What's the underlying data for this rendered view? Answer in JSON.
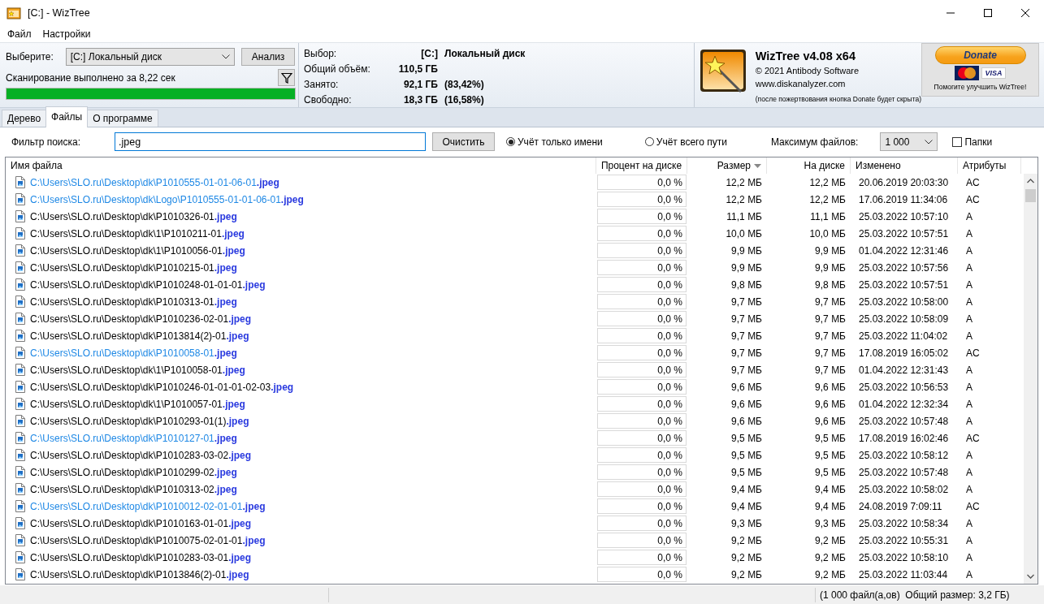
{
  "window": {
    "title": "[C:]  - WizTree"
  },
  "menu": [
    "Файл",
    "Настройки"
  ],
  "scan": {
    "select_label": "Выберите:",
    "drive": "[C:] Локальный диск",
    "analyze_button": "Анализ",
    "status": "Сканирование выполнено за 8,22 сек",
    "level": 1
  },
  "summary": [
    {
      "label": "Выбор:",
      "value": "[C:]",
      "extra": "Локальный диск"
    },
    {
      "label": "Общий объём:",
      "value": "110,5 ГБ"
    },
    {
      "label": "Занято:",
      "value": "92,1 ГБ",
      "extra": "(83,42%)"
    },
    {
      "label": "Свободно:",
      "value": "18,3 ГБ",
      "extra": "(16,58%)"
    }
  ],
  "about": {
    "product": "WizTree v4.08 x64",
    "copyright": "© 2021 Antibody Software",
    "website": "www.diskanalyzer.com",
    "note": "(после пожертвования кнопка Donate будет скрыта)"
  },
  "donate": {
    "button": "Donate",
    "card_text": "VISA",
    "caption": "Помогите улучшить WizTree!"
  },
  "tabs": [
    {
      "label": "Дерево",
      "selected": false
    },
    {
      "label": "Файлы",
      "selected": true
    },
    {
      "label": "О программе",
      "selected": false
    }
  ],
  "filter": {
    "label": "Фильтр поиска:",
    "value": ".jpeg",
    "clear_button": "Очистить",
    "match_options": [
      {
        "label": "Учёт только имени",
        "selected": true
      },
      {
        "label": "Учёт всего пути",
        "selected": false
      }
    ],
    "max_files_label": "Максимум файлов:",
    "max_files": "1 000",
    "folders": {
      "label": "Папки",
      "checked": false
    }
  },
  "table": {
    "columns": [
      {
        "label": "Имя файла",
        "sorted": false
      },
      {
        "label": "Процент на диске",
        "sorted": false
      },
      {
        "label": "Размер",
        "sorted": true
      },
      {
        "label": "На диске",
        "sorted": false
      },
      {
        "label": "Изменено",
        "sorted": false
      },
      {
        "label": "Атрибуты",
        "sorted": false
      }
    ],
    "rows": [
      {
        "path": "C:\\Users\\SLO.ru\\Desktop\\dk\\P1010555-01-01-06-01",
        "match": ".jpeg",
        "compressed": true,
        "percent": "0,0 %",
        "size": "12,2 МБ",
        "on_disk": "12,2 МБ",
        "modified": "20.06.2019 20:03:30",
        "attributes": "AC"
      },
      {
        "path": "C:\\Users\\SLO.ru\\Desktop\\dk\\Logo\\P1010555-01-01-06-01",
        "match": ".jpeg",
        "compressed": true,
        "percent": "0,0 %",
        "size": "12,2 МБ",
        "on_disk": "12,2 МБ",
        "modified": "17.06.2019 11:34:06",
        "attributes": "AC"
      },
      {
        "path": "C:\\Users\\SLO.ru\\Desktop\\dk\\P1010326-01",
        "match": ".jpeg",
        "compressed": false,
        "percent": "0,0 %",
        "size": "11,1 МБ",
        "on_disk": "11,1 МБ",
        "modified": "25.03.2022 10:57:10",
        "attributes": "A"
      },
      {
        "path": "C:\\Users\\SLO.ru\\Desktop\\dk\\1\\P1010211-01",
        "match": ".jpeg",
        "compressed": false,
        "percent": "0,0 %",
        "size": "10,0 МБ",
        "on_disk": "10,0 МБ",
        "modified": "25.03.2022 10:57:51",
        "attributes": "A"
      },
      {
        "path": "C:\\Users\\SLO.ru\\Desktop\\dk\\1\\P1010056-01",
        "match": ".jpeg",
        "compressed": false,
        "percent": "0,0 %",
        "size": "9,9 МБ",
        "on_disk": "9,9 МБ",
        "modified": "01.04.2022 12:31:46",
        "attributes": "A"
      },
      {
        "path": "C:\\Users\\SLO.ru\\Desktop\\dk\\P1010215-01",
        "match": ".jpeg",
        "compressed": false,
        "percent": "0,0 %",
        "size": "9,9 МБ",
        "on_disk": "9,9 МБ",
        "modified": "25.03.2022 10:57:56",
        "attributes": "A"
      },
      {
        "path": "C:\\Users\\SLO.ru\\Desktop\\dk\\P1010248-01-01-01",
        "match": ".jpeg",
        "compressed": false,
        "percent": "0,0 %",
        "size": "9,8 МБ",
        "on_disk": "9,8 МБ",
        "modified": "25.03.2022 10:57:51",
        "attributes": "A"
      },
      {
        "path": "C:\\Users\\SLO.ru\\Desktop\\dk\\P1010313-01",
        "match": ".jpeg",
        "compressed": false,
        "percent": "0,0 %",
        "size": "9,7 МБ",
        "on_disk": "9,7 МБ",
        "modified": "25.03.2022 10:58:00",
        "attributes": "A"
      },
      {
        "path": "C:\\Users\\SLO.ru\\Desktop\\dk\\P1010236-02-01",
        "match": ".jpeg",
        "compressed": false,
        "percent": "0,0 %",
        "size": "9,7 МБ",
        "on_disk": "9,7 МБ",
        "modified": "25.03.2022 10:58:09",
        "attributes": "A"
      },
      {
        "path": "C:\\Users\\SLO.ru\\Desktop\\dk\\P1013814(2)-01",
        "match": ".jpeg",
        "compressed": false,
        "percent": "0,0 %",
        "size": "9,7 МБ",
        "on_disk": "9,7 МБ",
        "modified": "25.03.2022 11:04:02",
        "attributes": "A"
      },
      {
        "path": "C:\\Users\\SLO.ru\\Desktop\\dk\\P1010058-01",
        "match": ".jpeg",
        "compressed": true,
        "percent": "0,0 %",
        "size": "9,7 МБ",
        "on_disk": "9,7 МБ",
        "modified": "17.08.2019 16:05:02",
        "attributes": "AC"
      },
      {
        "path": "C:\\Users\\SLO.ru\\Desktop\\dk\\1\\P1010058-01",
        "match": ".jpeg",
        "compressed": false,
        "percent": "0,0 %",
        "size": "9,7 МБ",
        "on_disk": "9,7 МБ",
        "modified": "01.04.2022 12:31:43",
        "attributes": "A"
      },
      {
        "path": "C:\\Users\\SLO.ru\\Desktop\\dk\\P1010246-01-01-01-02-03",
        "match": ".jpeg",
        "compressed": false,
        "percent": "0,0 %",
        "size": "9,6 МБ",
        "on_disk": "9,6 МБ",
        "modified": "25.03.2022 10:56:53",
        "attributes": "A"
      },
      {
        "path": "C:\\Users\\SLO.ru\\Desktop\\dk\\1\\P1010057-01",
        "match": ".jpeg",
        "compressed": false,
        "percent": "0,0 %",
        "size": "9,6 МБ",
        "on_disk": "9,6 МБ",
        "modified": "01.04.2022 12:32:34",
        "attributes": "A"
      },
      {
        "path": "C:\\Users\\SLO.ru\\Desktop\\dk\\P1010293-01(1)",
        "match": ".jpeg",
        "compressed": false,
        "percent": "0,0 %",
        "size": "9,6 МБ",
        "on_disk": "9,6 МБ",
        "modified": "25.03.2022 10:57:48",
        "attributes": "A"
      },
      {
        "path": "C:\\Users\\SLO.ru\\Desktop\\dk\\P1010127-01",
        "match": ".jpeg",
        "compressed": true,
        "percent": "0,0 %",
        "size": "9,5 МБ",
        "on_disk": "9,5 МБ",
        "modified": "17.08.2019 16:02:46",
        "attributes": "AC"
      },
      {
        "path": "C:\\Users\\SLO.ru\\Desktop\\dk\\P1010283-03-02",
        "match": ".jpeg",
        "compressed": false,
        "percent": "0,0 %",
        "size": "9,5 МБ",
        "on_disk": "9,5 МБ",
        "modified": "25.03.2022 10:58:12",
        "attributes": "A"
      },
      {
        "path": "C:\\Users\\SLO.ru\\Desktop\\dk\\P1010299-02",
        "match": ".jpeg",
        "compressed": false,
        "percent": "0,0 %",
        "size": "9,5 МБ",
        "on_disk": "9,5 МБ",
        "modified": "25.03.2022 10:57:48",
        "attributes": "A"
      },
      {
        "path": "C:\\Users\\SLO.ru\\Desktop\\dk\\P1010313-02",
        "match": ".jpeg",
        "compressed": false,
        "percent": "0,0 %",
        "size": "9,4 МБ",
        "on_disk": "9,4 МБ",
        "modified": "25.03.2022 10:58:02",
        "attributes": "A"
      },
      {
        "path": "C:\\Users\\SLO.ru\\Desktop\\dk\\P1010012-02-01-01",
        "match": ".jpeg",
        "compressed": true,
        "percent": "0,0 %",
        "size": "9,4 МБ",
        "on_disk": "9,4 МБ",
        "modified": "24.08.2019 7:09:11",
        "attributes": "AC"
      },
      {
        "path": "C:\\Users\\SLO.ru\\Desktop\\dk\\P1010163-01-01",
        "match": ".jpeg",
        "compressed": false,
        "percent": "0,0 %",
        "size": "9,3 МБ",
        "on_disk": "9,3 МБ",
        "modified": "25.03.2022 10:58:34",
        "attributes": "A"
      },
      {
        "path": "C:\\Users\\SLO.ru\\Desktop\\dk\\P1010075-02-01-01",
        "match": ".jpeg",
        "compressed": false,
        "percent": "0,0 %",
        "size": "9,2 МБ",
        "on_disk": "9,2 МБ",
        "modified": "25.03.2022 10:55:31",
        "attributes": "A"
      },
      {
        "path": "C:\\Users\\SLO.ru\\Desktop\\dk\\P1010283-03-01",
        "match": ".jpeg",
        "compressed": false,
        "percent": "0,0 %",
        "size": "9,2 МБ",
        "on_disk": "9,2 МБ",
        "modified": "25.03.2022 10:58:10",
        "attributes": "A"
      },
      {
        "path": "C:\\Users\\SLO.ru\\Desktop\\dk\\P1013846(2)-01",
        "match": ".jpeg",
        "compressed": false,
        "percent": "0,0 %",
        "size": "9,2 МБ",
        "on_disk": "9,2 МБ",
        "modified": "25.03.2022 11:03:44",
        "attributes": "A"
      }
    ]
  },
  "status_bar": {
    "summary": "(1 000 файл(а,ов)  Общий размер: 3,2 ГБ)"
  }
}
